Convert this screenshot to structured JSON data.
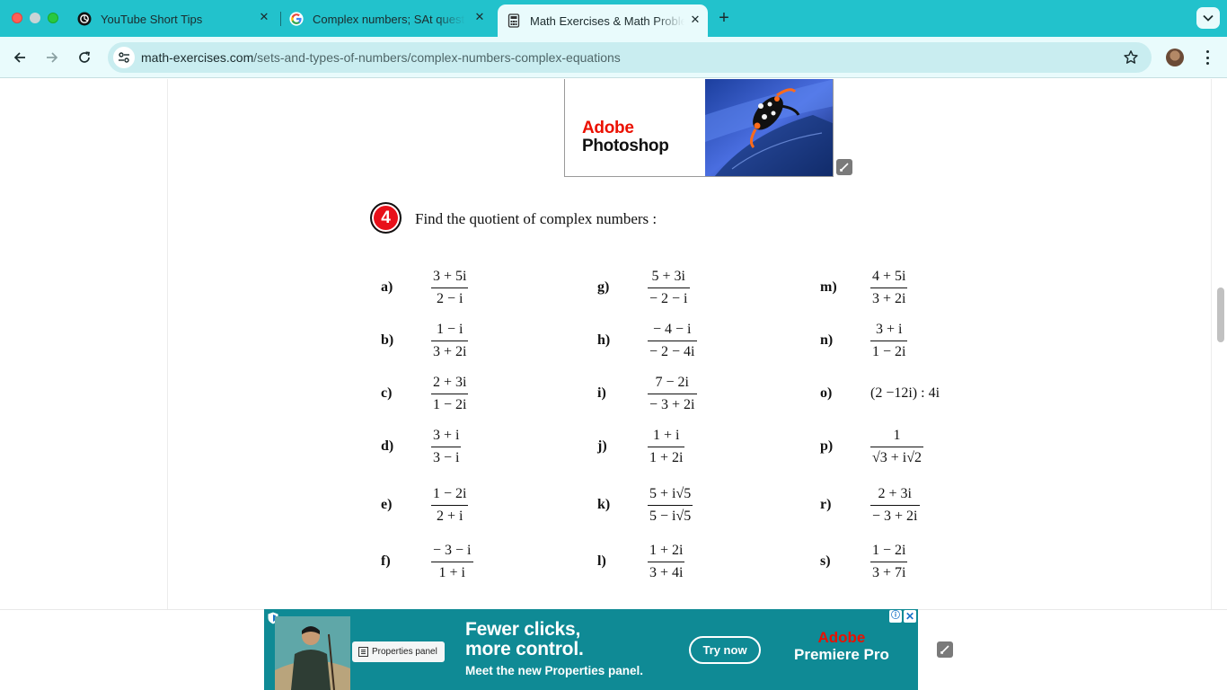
{
  "colors": {
    "tab_strip": "#22c2cc",
    "toolbar": "#e9fbfc",
    "omnibox": "#c9edf0",
    "exercise_badge": "#e8101a",
    "bottom_ad_bg": "#0f8a95",
    "adobe_red": "#eb1000"
  },
  "tabs": [
    {
      "title": "YouTube Short Tips",
      "icon": "chatgpt-icon",
      "active": false
    },
    {
      "title": "Complex numbers; SAt questions",
      "icon": "google-icon",
      "active": false
    },
    {
      "title": "Math Exercises & Math Problems",
      "icon": "calculator-icon",
      "active": true
    }
  ],
  "toolbar": {
    "url_domain": "math-exercises.com",
    "url_path": "/sets-and-types-of-numbers/complex-numbers-complex-equations"
  },
  "top_ad": {
    "brand_line1": "Adobe",
    "brand_line2": "Photoshop"
  },
  "exercise": {
    "number": "4",
    "title": "Find the quotient of complex numbers :",
    "problems": [
      {
        "label": "a)",
        "num": "3 + 5i",
        "den": "2 − i"
      },
      {
        "label": "b)",
        "num": "1 − i",
        "den": "3 + 2i"
      },
      {
        "label": "c)",
        "num": "2 + 3i",
        "den": "1 − 2i"
      },
      {
        "label": "d)",
        "num": "3 + i",
        "den": "3 − i"
      },
      {
        "label": "e)",
        "num": "1 − 2i",
        "den": "2 + i"
      },
      {
        "label": "f)",
        "num": "− 3 − i",
        "den": "1 + i"
      },
      {
        "label": "g)",
        "num": "5 + 3i",
        "den": "− 2 − i"
      },
      {
        "label": "h)",
        "num": "− 4 − i",
        "den": "− 2 − 4i"
      },
      {
        "label": "i)",
        "num": "7 − 2i",
        "den": "− 3 + 2i"
      },
      {
        "label": "j)",
        "num": "1 + i",
        "den": "1 + 2i"
      },
      {
        "label": "k)",
        "num": "5 + i√5",
        "den": "5 − i√5"
      },
      {
        "label": "l)",
        "num": "1 + 2i",
        "den": "3 + 4i"
      },
      {
        "label": "m)",
        "num": "4 + 5i",
        "den": "3 + 2i"
      },
      {
        "label": "n)",
        "num": "3 + i",
        "den": "1 − 2i"
      },
      {
        "label": "o)",
        "inline": "(2 −12i) : 4i"
      },
      {
        "label": "p)",
        "num": "1",
        "den": "√3 + i√2"
      },
      {
        "label": "r)",
        "num": "2 + 3i",
        "den": "− 3 + 2i"
      },
      {
        "label": "s)",
        "num": "1 − 2i",
        "den": "3 + 7i"
      }
    ]
  },
  "bottom_ad": {
    "panel_chip": "Properties panel",
    "headline_line1": "Fewer clicks,",
    "headline_line2": "more control.",
    "subline": "Meet the new Properties panel.",
    "cta": "Try now",
    "brand_line1": "Adobe",
    "brand_line2": "Premiere Pro",
    "adchoices": "ⓘ",
    "close": "✕"
  }
}
